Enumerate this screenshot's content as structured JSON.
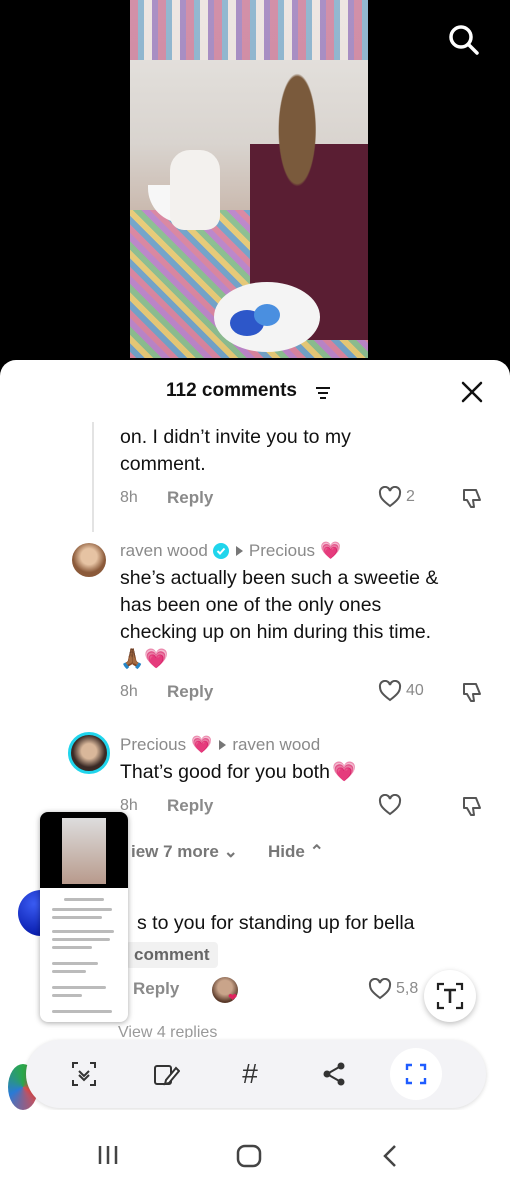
{
  "header": {
    "comment_count": "112 comments"
  },
  "comments": [
    {
      "id": "c0",
      "text_line1": "on. I didn’t invite you to my",
      "text_line2": "comment.",
      "time": "8h",
      "reply_label": "Reply",
      "likes": "2"
    },
    {
      "id": "c1",
      "author": "raven wood",
      "reply_to": "Precious",
      "text_lines": [
        "she’s actually been such a sweetie &",
        "has been one of the only ones",
        "checking up on him during this time."
      ],
      "emoji_line": "🙏🏾💗",
      "time": "8h",
      "reply_label": "Reply",
      "likes": "40"
    },
    {
      "id": "c2",
      "author": "Precious",
      "reply_to": "raven wood",
      "text": "That’s good for you both",
      "time": "8h",
      "reply_label": "Reply",
      "likes": ""
    }
  ],
  "thread_controls": {
    "view_more": "iew 7 more",
    "hide": "Hide"
  },
  "comment3": {
    "text": "s to you for standing up for bella",
    "add_comment": "comment",
    "reply_label": "Reply",
    "likes": "5,8"
  },
  "view_replies": "View 4 replies",
  "toolbar": {
    "items": [
      "scan-icon",
      "edit-icon",
      "hashtag-icon",
      "share-icon",
      "expand-icon"
    ],
    "hashtag_label": "#"
  },
  "colors": {
    "pink_heart": "#f7a3d6",
    "verified": "#20d5ec",
    "accent_blue": "#1f5cff"
  }
}
